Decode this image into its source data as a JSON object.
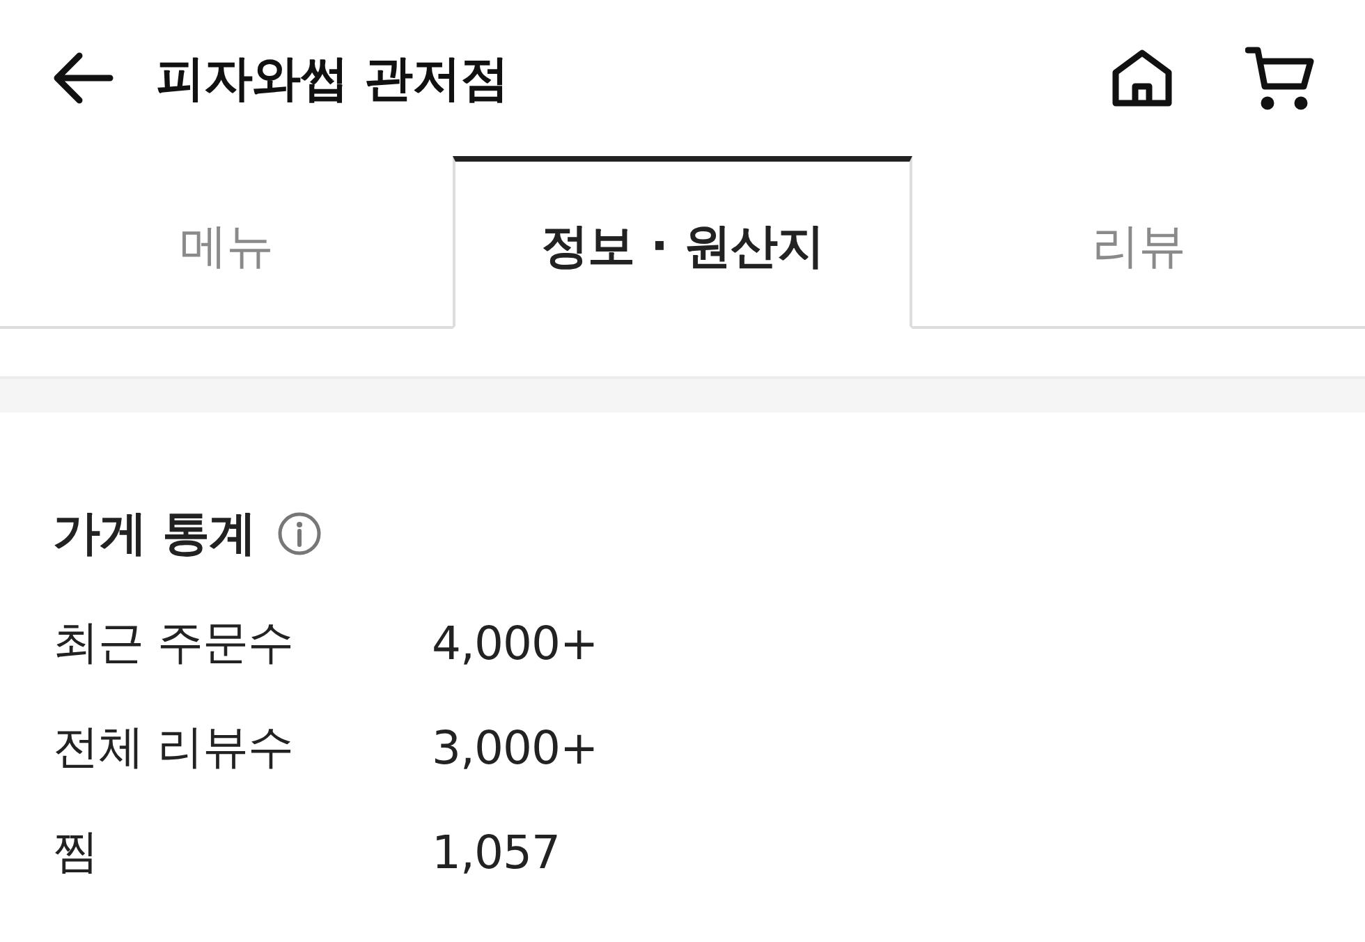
{
  "header": {
    "title": "피자와썹 관저점"
  },
  "tabs": [
    {
      "label": "메뉴",
      "selected": false
    },
    {
      "label": "정보 · 원산지",
      "selected": true
    },
    {
      "label": "리뷰",
      "selected": false
    }
  ],
  "store_stats": {
    "title": "가게 통계",
    "rows": [
      {
        "label": "최근 주문수",
        "value": "4,000+"
      },
      {
        "label": "전체 리뷰수",
        "value": "3,000+"
      },
      {
        "label": "찜",
        "value": "1,057"
      }
    ]
  }
}
